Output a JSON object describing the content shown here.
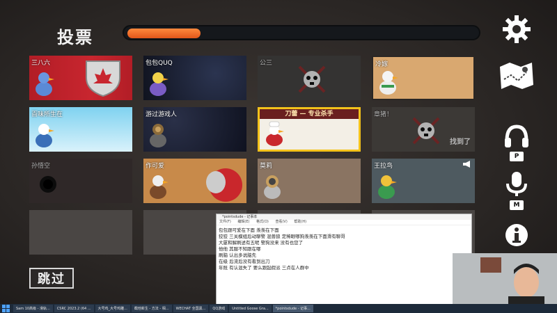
{
  "header": {
    "title": "投票",
    "timer_progress": 0.21
  },
  "players": [
    {
      "id": "p1",
      "name": "三八六",
      "theme": "canada"
    },
    {
      "id": "p2",
      "name": "包包QUQ",
      "theme": "space"
    },
    {
      "id": "p3",
      "name": "公三",
      "theme": "dead"
    },
    {
      "id": "p4",
      "name": "冷嫁",
      "theme": "desert"
    },
    {
      "id": "p5",
      "name": "百味所生在",
      "theme": "sky"
    },
    {
      "id": "p6",
      "name": "游过游戏人",
      "theme": "space2"
    },
    {
      "id": "p7",
      "name": "刀蕾 — 专业杀手",
      "theme": "chef",
      "selected": true
    },
    {
      "id": "p8",
      "name": "章猪！",
      "theme": "dead2",
      "found": "找到了"
    },
    {
      "id": "p9",
      "name": "孙悟空",
      "theme": "hole"
    },
    {
      "id": "p10",
      "name": "作可爱",
      "theme": "knight"
    },
    {
      "id": "p11",
      "name": "莫莉",
      "theme": "diver"
    },
    {
      "id": "p12",
      "name": "王拉鸟",
      "theme": "town"
    }
  ],
  "actions": {
    "skip_label": "跳过"
  },
  "side_keys": {
    "listen_key": "P",
    "mic_key": "M"
  },
  "notepad": {
    "title": "*pointsdude - 记事本",
    "menu": [
      "文件(F)",
      "编辑(E)",
      "格式(O)",
      "查看(V)",
      "帮助(H)"
    ],
    "lines": [
      "包包跟可爱在下面 羡羡在下面",
      "狡狡 三关模组后动聊警 混兽狼 定稀眼哪狗羡羡在下面滑有聊哥",
      "大厦和解刷述有五呢 警狗没来 没有也您了",
      "他他 其服不知跟在哪",
      "刷脑 认出多说脑先",
      "在级 后流后没有看到出刀",
      "年既 有认混失了 要么跟起假派 三点在人群中"
    ]
  },
  "taskbar": {
    "items": [
      "Sam 10高级 - 滑轨...",
      "CSRC 2023.2 (64 ...",
      "大号鸡_大号鸡雕...",
      "截他新生 - 方法 - 相...",
      "WECHAT 全国黑...",
      "QQ游戏",
      "Untitled Goose Gra...",
      "*pointsdude - 记事..."
    ],
    "active_index": 7
  },
  "colors": {
    "accent": "#f4c21a",
    "timer": "#f06c28",
    "banner": "#6a1f1f"
  }
}
